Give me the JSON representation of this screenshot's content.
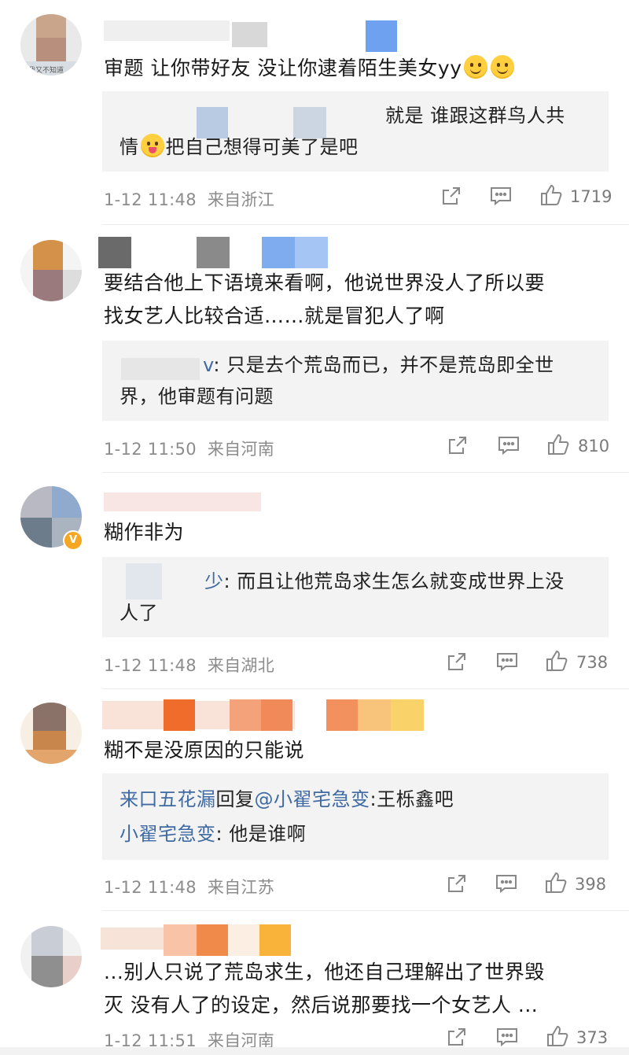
{
  "comments": [
    {
      "body": "审题 让你带好友 没让你逮着陌生美女yy",
      "reply_lines": [
        "就是 谁跟这群鸟人共",
        "情",
        "把自己想得可美了是吧"
      ],
      "time": "1-12 11:48",
      "location": "来自浙江",
      "likes": "1719"
    },
    {
      "body_line1": "要结合他上下语境来看啊，他说世界没人了所以要",
      "body_line2": "找女艺人比较合适……就是冒犯人了啊",
      "reply_user_fragment": "v",
      "reply_line1": ": 只是去个荒岛而已，并不是荒岛即全世",
      "reply_line2": "界，他审题有问题",
      "time": "1-12 11:50",
      "location": "来自河南",
      "likes": "810"
    },
    {
      "body": "糊作非为",
      "reply_user_fragment": "少",
      "reply_line1": ": 而且让他荒岛求生怎么就变成世界上没",
      "reply_line2": "人了",
      "time": "1-12 11:48",
      "location": "来自湖北",
      "likes": "738"
    },
    {
      "body": "糊不是没原因的只能说",
      "reply1_user": "来口五花漏",
      "reply1_mid": "回复",
      "reply1_target": "@小翟宅急变",
      "reply1_text": ":王栎鑫吧",
      "reply2_user": "小翟宅急变",
      "reply2_text": ": 他是谁啊",
      "time": "1-12 11:48",
      "location": "来自江苏",
      "likes": "398"
    },
    {
      "body_line1": "...别人只说了荒岛求生，他还自己理解出了世界毁",
      "body_line2": "灭 没有人了的设定，然后说那要找一个女艺人 ...",
      "time": "1-12 11:51",
      "location": "来自河南",
      "likes": "373"
    }
  ],
  "avatar_caption_1": "我又不知道",
  "icons": {
    "share": "share-icon",
    "reply": "comment-icon",
    "like": "thumbs-up-icon",
    "verified": "verified-badge-icon"
  },
  "colors": {
    "link_blue": "#3f6aa3",
    "meta_gray": "#8c8c8c",
    "reply_bg": "#f3f3f3"
  }
}
